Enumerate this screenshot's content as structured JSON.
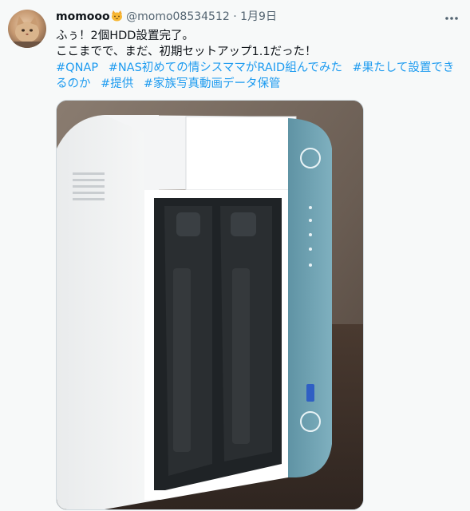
{
  "tweet": {
    "author_name": "momooo",
    "author_badge_icon": "cat-emoji-icon",
    "handle": "@momo08534512",
    "separator": "·",
    "date": "1月9日",
    "lines": {
      "line1": "ふぅ！2個HDD設置完了。",
      "line2": "ここまでで、まだ、初期セットアップ1.1だった！"
    },
    "hashtags": {
      "tag1": "#QNAP",
      "tag2": "#NAS初めての情シスママがRAID組んでみた",
      "tag3a": "#果たして設置でき",
      "tag3b": "るのか",
      "tag4": "#提供",
      "tag5": "#家族写真動画データ保管"
    },
    "more_icon": "more-options-icon",
    "media": {
      "description_icon": "nas-photo",
      "accent_color": "#6fa3b3"
    }
  },
  "colors": {
    "link": "#1d9bf0",
    "muted": "#536471",
    "text": "#0f1419",
    "background": "#f7f9f9"
  }
}
